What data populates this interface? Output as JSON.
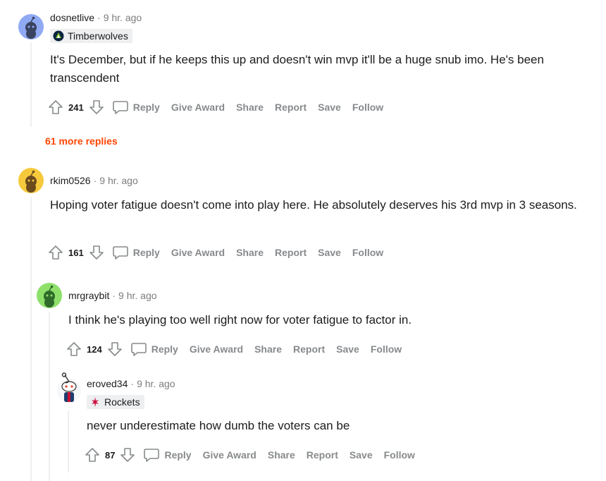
{
  "comments": [
    {
      "username": "dosnetlive",
      "time": "9 hr. ago",
      "flair": "Timberwolves",
      "text": "It's December, but if he keeps this up and doesn't win mvp it'll be a huge snub imo. He's been transcendent",
      "score": "241",
      "avatar_color": "#8fa9f3"
    },
    {
      "username": "rkim0526",
      "time": "9 hr. ago",
      "text": "Hoping voter fatigue doesn't come into play here. He absolutely deserves his 3rd mvp in 3 seasons.",
      "score": "161",
      "avatar_color": "#f6c93c"
    },
    {
      "username": "mrgraybit",
      "time": "9 hr. ago",
      "text": "I think he's playing too well right now for voter fatigue to factor in.",
      "score": "124",
      "avatar_color": "#8ee06b"
    },
    {
      "username": "eroved34",
      "time": "9 hr. ago",
      "flair": "Rockets",
      "text": "never underestimate how dumb the voters can be",
      "score": "87",
      "avatar_color": "#ffffff"
    }
  ],
  "more_replies": "61 more replies",
  "actions": {
    "reply": "Reply",
    "give_award": "Give Award",
    "share": "Share",
    "report": "Report",
    "save": "Save",
    "follow": "Follow"
  },
  "colors": {
    "accent": "#ff4500",
    "muted": "#878a8c",
    "thread": "#edeff1"
  }
}
